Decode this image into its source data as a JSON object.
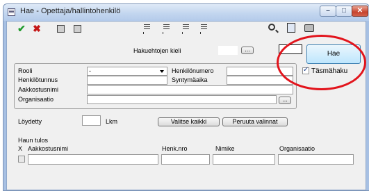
{
  "window": {
    "title": "Hae - Opettaja/hallintohenkilö"
  },
  "toolbar": {
    "icons": [
      "check-icon",
      "cross-icon",
      "window-icon",
      "window-icon",
      "document-icon",
      "document-icon",
      "document-icon",
      "document-icon",
      "search-icon",
      "book-icon",
      "printer-icon"
    ],
    "check_glyph": "✔",
    "cross_glyph": "✖"
  },
  "search_language": {
    "label": "Hakuehtojen kieli",
    "button": "...",
    "value": ""
  },
  "hae_button": {
    "label": "Hae"
  },
  "exact_search": {
    "label": "Täsmähaku",
    "checked": true
  },
  "form": {
    "rooli": {
      "label": "Rooli",
      "value": "-"
    },
    "henkilonumero": {
      "label": "Henkilönumero",
      "value": ""
    },
    "henkilotunnus": {
      "label": "Henkilötunnus",
      "value": ""
    },
    "syntymaaika": {
      "label": "Syntymäaika",
      "value": ""
    },
    "aakkostusnimi": {
      "label": "Aakkostusnimi",
      "value": ""
    },
    "organisaatio": {
      "label": "Organisaatio",
      "value": "",
      "button": "..."
    }
  },
  "found": {
    "label": "Löydetty",
    "count_label": "Lkm",
    "value": ""
  },
  "buttons": {
    "select_all": "Valitse kaikki",
    "cancel_selection": "Peruuta valinnat"
  },
  "results": {
    "title": "Haun tulos",
    "columns": [
      "X",
      "Aakkostusnimi",
      "Henk.nro",
      "Nimike",
      "Organisaatio"
    ]
  },
  "colors": {
    "highlight_ellipse": "#e2141c",
    "check": "#1e9a2a",
    "cross": "#c41616"
  }
}
